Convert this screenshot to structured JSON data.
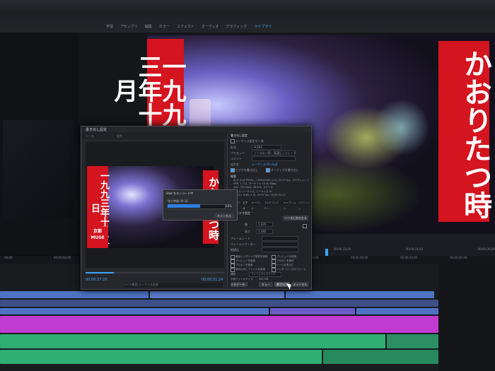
{
  "app": {
    "workspace_tabs": [
      "学習",
      "アセンブリ",
      "編集",
      "カラー",
      "エフェクト",
      "オーディオ",
      "グラフィック",
      "ライブラリ"
    ],
    "active_tab": "ライブラリ"
  },
  "program_monitor": {
    "banner_left": "一九九三年十月",
    "banner_right": "かおりたつ時",
    "ruler_ticks": [
      "00;00;20;00",
      "00;00;22;00",
      "00;00;24;00",
      "00;00;26;00"
    ]
  },
  "export_dialog": {
    "title": "書き出し設定",
    "tabs": [
      "ソース",
      "出力"
    ],
    "thumb_left_banner": "一九九三年十月五日",
    "thumb_right_banner": "かおりたつ時",
    "thumb_city": "京都 MUSE",
    "timecode_in": "00;00;37;20",
    "timecode_out": "00;05;51;24",
    "source_range_label": "ソース範囲",
    "source_range_value": "シーケンス全体",
    "settings": {
      "header": "書き出し設定",
      "rows": [
        {
          "label": "シーケンス設定を一致",
          "type": "checkbox"
        },
        {
          "label": "形式",
          "value": "H.264"
        },
        {
          "label": "プリセット",
          "value": "ソースの一致 - 高速ビットレート"
        },
        {
          "label": "コメント",
          "value": ""
        },
        {
          "label": "出力名",
          "value": "シーケンス 01.mp4"
        }
      ],
      "export_video": "ビデオを書き出し",
      "export_audio": "オーディオを書き出し",
      "summary": "概要",
      "summary_lines": [
        "出力: D:\\¥ PHYS\\... 1920x1080 (1.0), 29.97 fps, プログレッシブ",
        "VBR, 1 パス, ターゲット 10.00 Mbps",
        "AAC, 320 kbps, 48 kHz, ステレオ",
        "ソース: シーケンス, シーケンス 01",
        "1920 x 1080 (1.0), 29.97 fps, 00;05;51;24"
      ],
      "panel_tabs": [
        "エフェクト",
        "ビデオ",
        "オーディオ",
        "マルチプレクサー",
        "キャプション",
        "パブリッシュ"
      ],
      "basic_video": "基本ビデオ設定",
      "match_source": "ソースに合わせる",
      "width_label": "幅",
      "width_value": "1,920",
      "height_label": "高さ",
      "height_value": "1,080",
      "frame_rate_label": "フレームレート",
      "field_order_label": "フィールドオーダー",
      "aspect_label": "縦横比",
      "options_left": [
        "最高レンダリング品質を使用",
        "プレビューを使用",
        "プロキシを使用",
        "読み込みにファイルを使用"
      ],
      "options_right": [
        "プレビューを使用",
        "プロキシを使用",
        "ソースを表示に",
        "インターレースのフレーム"
      ],
      "interpolation_label": "補間",
      "interpolation_value": "フレームサンプリング",
      "filesize_label": "予測ファイルサイズ",
      "filesize_value": "435 MB",
      "btn_metadata": "メタデータ...",
      "btn_queue": "キュー",
      "btn_export": "書き出し",
      "btn_cancel": "キャンセル"
    }
  },
  "encoding_modal": {
    "title": "Vaxt をエンコード中",
    "remaining_label": "残り時間",
    "remaining_value": "00:10",
    "progress_label": "58%",
    "progress_fraction": 0.58,
    "cancel_label": "キャンセル"
  },
  "timeline": {
    "ruler": [
      "00;00",
      "00;00;04;00",
      "00;00;08;00",
      "00;00;12;00",
      "00;00;16;00",
      "00;00;20;00",
      "00;00;24;00",
      "00;00;28;00",
      "00;00;32;00",
      "00;00;36;00"
    ]
  },
  "colors": {
    "accent": "#3fa3ff",
    "banner_red": "#d4141f",
    "clip_blue": "#4f73c4",
    "clip_magenta": "#c23bd0",
    "audio_green": "#2fae74"
  }
}
